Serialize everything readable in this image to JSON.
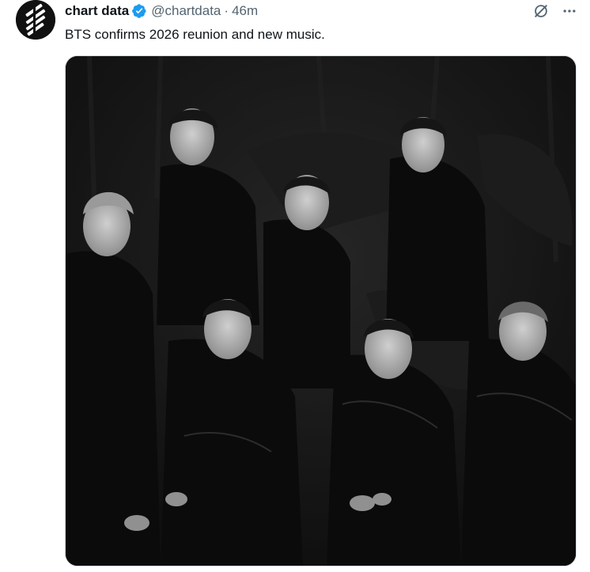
{
  "tweet": {
    "author": {
      "display_name": "chart data",
      "handle": "@chartdata",
      "verified": true
    },
    "separator": "·",
    "timestamp": "46m",
    "text": "BTS confirms 2026 reunion and new music.",
    "media": {
      "kind": "photo",
      "style": "black-and-white group portrait"
    }
  },
  "icons": {
    "avatar": "chart-data-logo-icon",
    "verified": "verified-badge-icon",
    "grok": "grok-icon",
    "more": "more-options-icon"
  },
  "colors": {
    "text_primary": "#0f1419",
    "text_secondary": "#536471",
    "verified_blue": "#1d9bf0",
    "border": "#cfd9de"
  }
}
